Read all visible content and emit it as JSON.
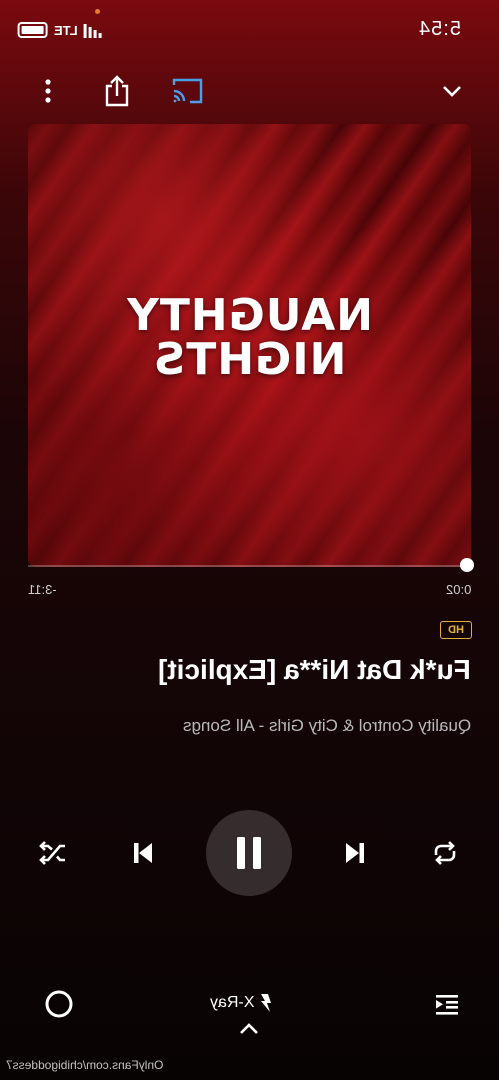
{
  "status_bar": {
    "time": "5:54",
    "network": "LTE"
  },
  "artwork": {
    "line1": "NAUGHTY",
    "line2": "NIGHTS"
  },
  "playback": {
    "elapsed": "0:02",
    "remaining": "-3:11",
    "progress_fraction": 0.01
  },
  "track": {
    "quality_badge": "HD",
    "title": "Fu*k Dat Ni**a [Explicit]",
    "subtitle": "Quality Control & City Girls - All Songs"
  },
  "bottom_bar": {
    "xray_label": "X-Ray"
  },
  "watermark": "OnlyFans.com/chibigoddess7",
  "colors": {
    "accent_cast": "#4a9fe8",
    "hd_badge": "#e0b13a",
    "background_top": "#7a0a0f"
  },
  "icons": {
    "more": "more-vertical-icon",
    "share": "share-icon",
    "cast": "cast-icon",
    "collapse": "chevron-down-icon",
    "shuffle": "shuffle-icon",
    "previous": "skip-previous-icon",
    "pause": "pause-icon",
    "next": "skip-next-icon",
    "repeat": "repeat-icon",
    "alexa": "alexa-icon",
    "xray": "lightning-icon",
    "queue": "queue-icon"
  }
}
